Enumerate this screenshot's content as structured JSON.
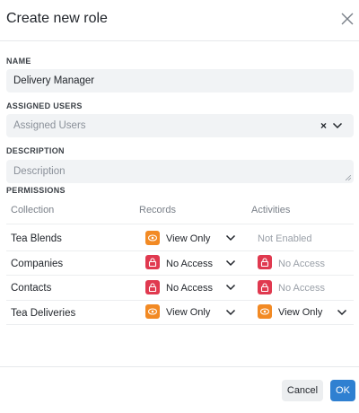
{
  "dialog": {
    "title": "Create new role"
  },
  "name_field": {
    "label": "NAME",
    "value": "Delivery Manager"
  },
  "assigned_users": {
    "label": "ASSIGNED USERS",
    "placeholder": "Assigned Users",
    "clear_glyph": "×"
  },
  "description": {
    "label": "DESCRIPTION",
    "placeholder": "Description"
  },
  "permissions": {
    "label": "PERMISSIONS",
    "columns": [
      "Collection",
      "Records",
      "Activities"
    ],
    "rows": [
      {
        "collection": "Tea Blends",
        "records": {
          "value": "View Only",
          "icon": "eye-icon"
        },
        "activities": {
          "value": "Not Enabled",
          "icon": "",
          "enabled": false
        }
      },
      {
        "collection": "Companies",
        "records": {
          "value": "No Access",
          "icon": "lock-icon"
        },
        "activities": {
          "value": "No Access",
          "icon": "lock-icon",
          "enabled": false
        }
      },
      {
        "collection": "Contacts",
        "records": {
          "value": "No Access",
          "icon": "lock-icon"
        },
        "activities": {
          "value": "No Access",
          "icon": "lock-icon",
          "enabled": false
        }
      },
      {
        "collection": "Tea Deliveries",
        "records": {
          "value": "View Only",
          "icon": "eye-icon"
        },
        "activities": {
          "value": "View Only",
          "icon": "eye-icon",
          "enabled": true
        }
      }
    ]
  },
  "footer": {
    "cancel_label": "Cancel",
    "ok_label": "OK"
  },
  "colors": {
    "view_badge": "#f28a24",
    "no_access_badge": "#e0394f",
    "primary": "#2f80d1"
  }
}
